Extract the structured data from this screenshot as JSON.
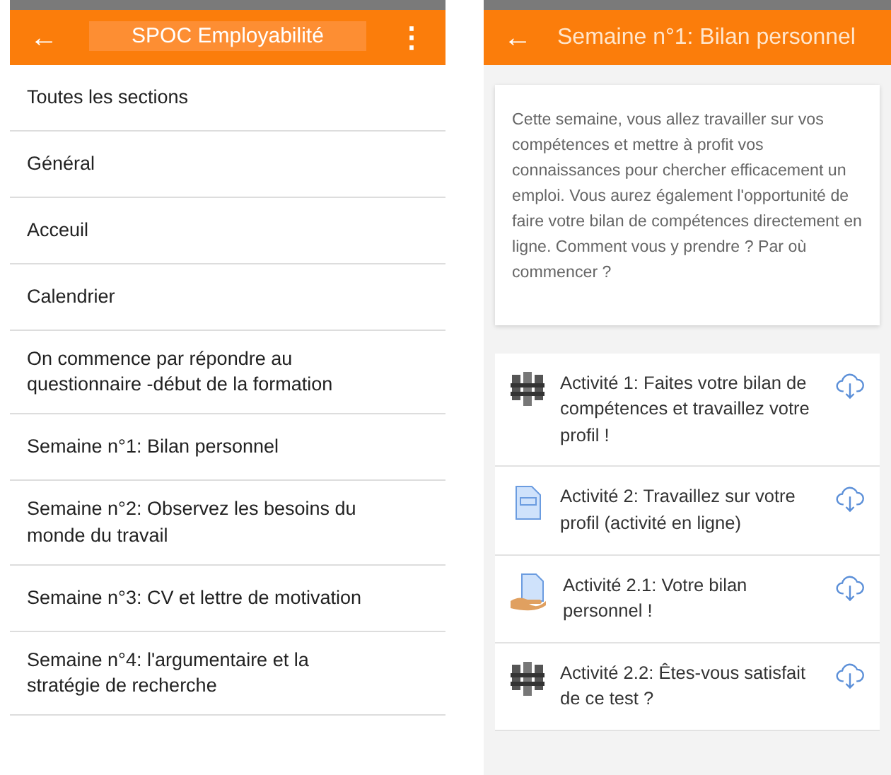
{
  "left_screen": {
    "app_bar": {
      "back": "←",
      "title": "SPOC Employabilité",
      "menu": "⋮"
    },
    "sections": [
      {
        "label": "Toutes les sections"
      },
      {
        "label": "Général"
      },
      {
        "label": "Acceuil"
      },
      {
        "label": "Calendrier"
      },
      {
        "label": "On commence par répondre au questionnaire -début de la formation"
      },
      {
        "label": "Semaine n°1: Bilan personnel"
      },
      {
        "label": "Semaine n°2: Observez les besoins du monde du travail"
      },
      {
        "label": "Semaine n°3: CV et lettre de motivation"
      },
      {
        "label": "Semaine n°4: l'argumentaire et la stratégie de recherche"
      }
    ]
  },
  "right_screen": {
    "app_bar": {
      "back": "←",
      "title": "Semaine n°1: Bilan personnel"
    },
    "summary": "Cette semaine, vous allez travailler sur vos compétences et mettre à profit vos connaissances pour chercher efficacement un emploi. Vous aurez également l'opportunité de faire votre bilan de compétences directement en ligne. Comment vous y prendre ? Par où commencer ?",
    "activities": [
      {
        "kind": "quiz",
        "label": "Activité 1: Faites votre bilan de compétences et travaillez votre profil !"
      },
      {
        "kind": "page",
        "label": "Activité 2: Travaillez sur votre profil (activité en ligne)"
      },
      {
        "kind": "assign",
        "label": "Activité 2.1: Votre bilan personnel !"
      },
      {
        "kind": "quiz",
        "label": "Activité 2.2: Êtes-vous satisfait de ce test ?"
      }
    ]
  }
}
